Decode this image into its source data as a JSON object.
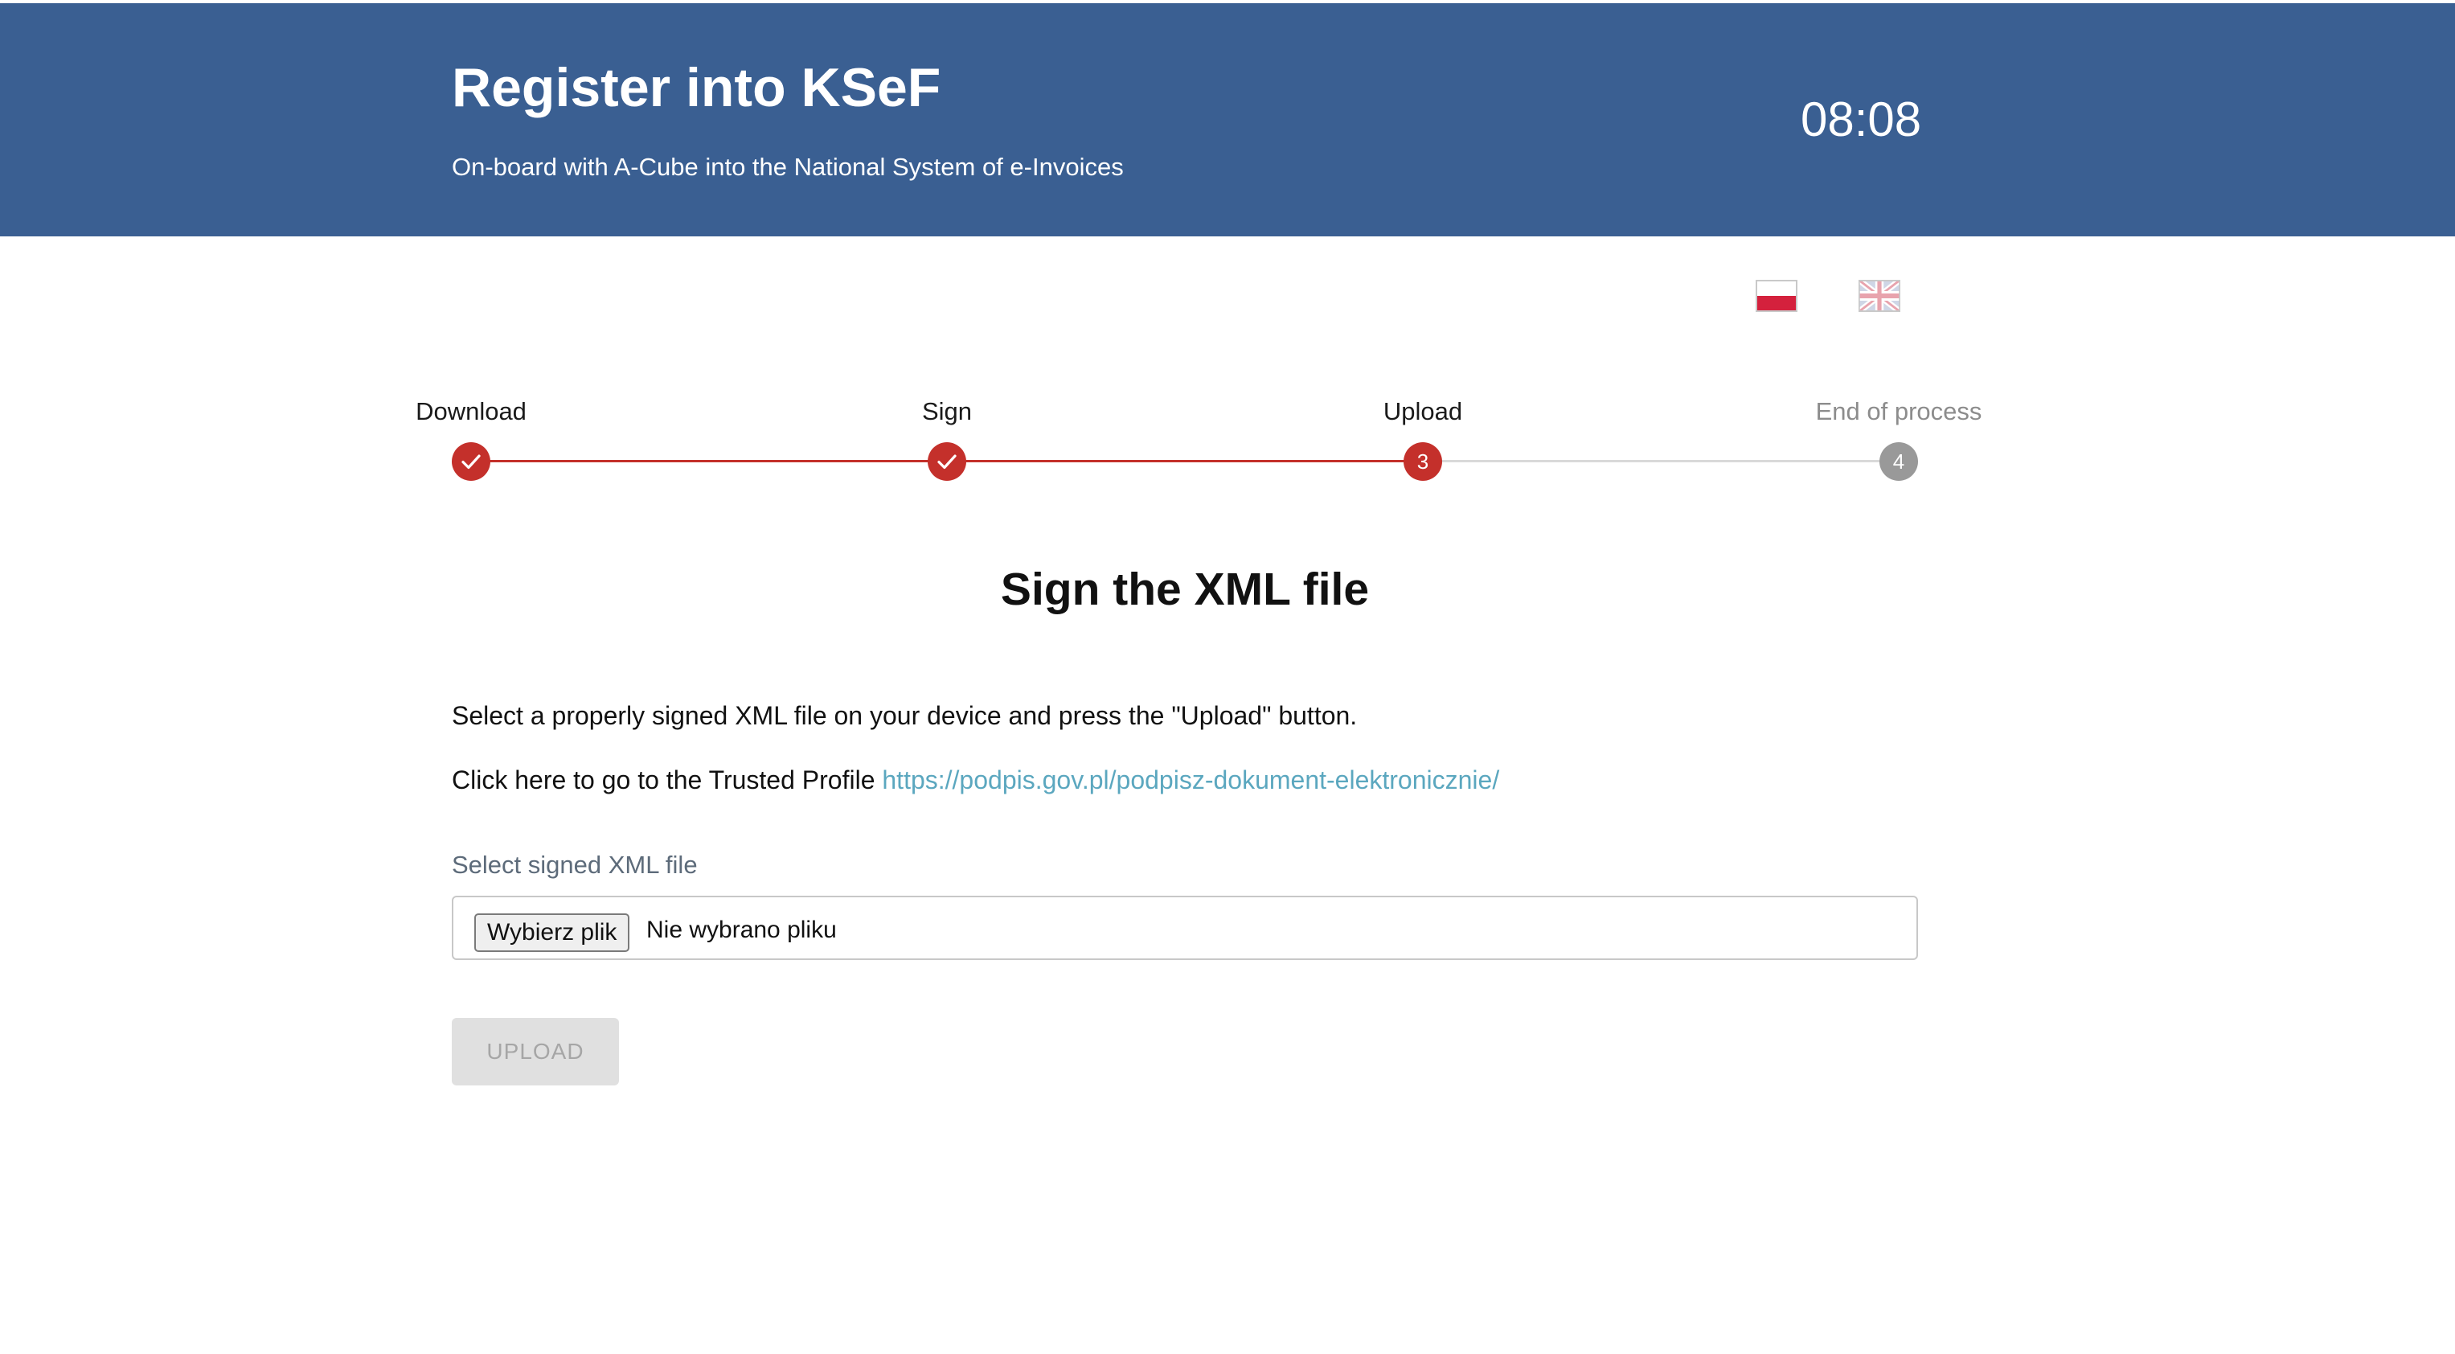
{
  "header": {
    "title": "Register into KSeF",
    "subtitle": "On-board with A-Cube into the National System of e-Invoices",
    "timer": "08:08",
    "background_color": "#3a5f92"
  },
  "languages": [
    {
      "code": "pl",
      "icon": "poland-flag-icon"
    },
    {
      "code": "en",
      "icon": "uk-flag-icon"
    }
  ],
  "stepper": {
    "accent_color": "#c4302b",
    "steps": [
      {
        "label": "Download",
        "status": "completed",
        "number": "1"
      },
      {
        "label": "Sign",
        "status": "completed",
        "number": "2"
      },
      {
        "label": "Upload",
        "status": "active",
        "number": "3"
      },
      {
        "label": "End of process",
        "status": "pending",
        "number": "4"
      }
    ]
  },
  "main": {
    "title": "Sign the XML file",
    "instruction": "Select a properly signed XML file on your device and press the \"Upload\" button.",
    "trusted_profile_text": "Click here to go to the Trusted Profile",
    "trusted_profile_link": "https://podpis.gov.pl/podpisz-dokument-elektronicznie/",
    "file_field_label": "Select signed XML file",
    "file_button_label": "Wybierz plik",
    "file_status": "Nie wybrano pliku",
    "upload_button_label": "UPLOAD",
    "link_color": "#5ba7bf"
  }
}
